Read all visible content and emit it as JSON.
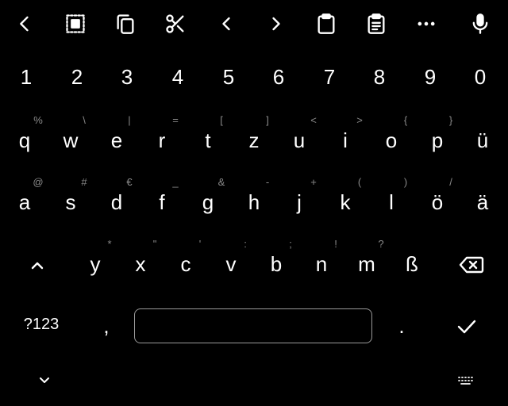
{
  "toolbar": {
    "icons": [
      "chevron-left-icon",
      "select-all-icon",
      "copy-icon",
      "cut-icon",
      "cursor-left-icon",
      "cursor-right-icon",
      "clipboard-icon",
      "clipboard-text-icon",
      "more-icon",
      "mic-icon"
    ]
  },
  "number_row": [
    "1",
    "2",
    "3",
    "4",
    "5",
    "6",
    "7",
    "8",
    "9",
    "0"
  ],
  "row1": {
    "letters": [
      "q",
      "w",
      "e",
      "r",
      "t",
      "z",
      "u",
      "i",
      "o",
      "p",
      "ü"
    ],
    "hints": [
      "%",
      "\\",
      "|",
      "=",
      "[",
      "]",
      "<",
      ">",
      "{",
      "}"
    ]
  },
  "row2": {
    "letters": [
      "a",
      "s",
      "d",
      "f",
      "g",
      "h",
      "j",
      "k",
      "l",
      "ö",
      "ä"
    ],
    "hints": [
      "@",
      "#",
      "€",
      "_",
      "&",
      "-",
      "+",
      "(",
      ")",
      "/"
    ]
  },
  "row3": {
    "letters": [
      "y",
      "x",
      "c",
      "v",
      "b",
      "n",
      "m",
      "ß"
    ],
    "hints": [
      "*",
      "\"",
      "'",
      ":",
      ";",
      "!",
      "?"
    ]
  },
  "bottom": {
    "symbols_label": "?123",
    "comma_label": ",",
    "period_label": ".",
    "space_value": ""
  },
  "colors": {
    "background": "#000000",
    "key_text": "#ffffff",
    "hint_text": "#8a8a8a",
    "space_border": "#9a9a9a"
  }
}
